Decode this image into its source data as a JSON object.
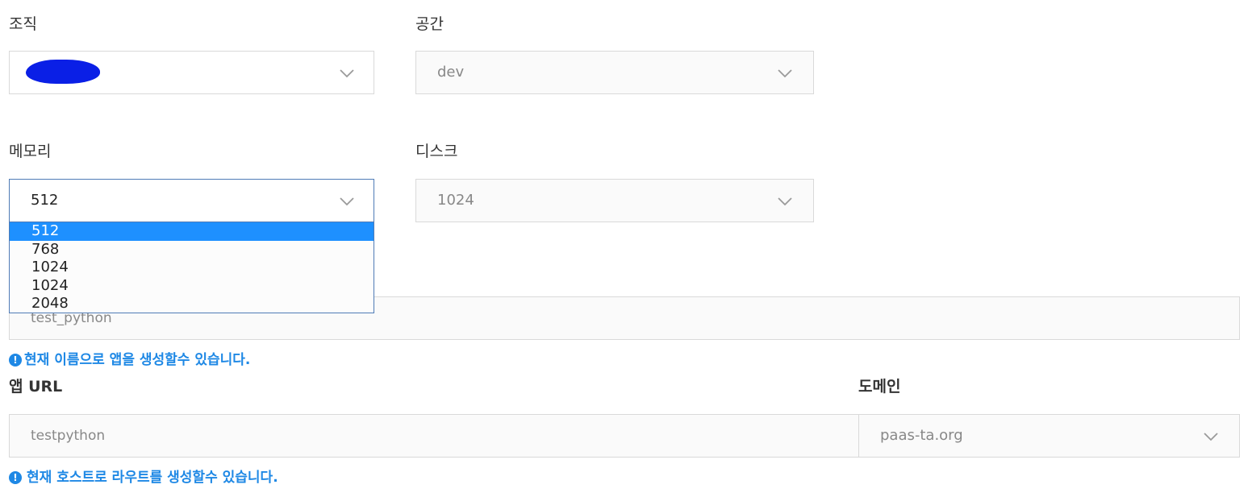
{
  "org": {
    "label": "조직",
    "icon": "chevron-down-icon"
  },
  "space": {
    "label": "공간",
    "value": "dev",
    "icon": "chevron-down-icon"
  },
  "memory": {
    "label": "메모리",
    "value": "512",
    "options": [
      "512",
      "768",
      "1024",
      "1024",
      "2048"
    ],
    "selected_index": 0,
    "icon": "chevron-down-icon"
  },
  "disk": {
    "label": "디스크",
    "value": "1024",
    "icon": "chevron-down-icon"
  },
  "app_name": {
    "value": "test_python",
    "hint": "현재 이름으로 앱을 생성할수 있습니다.",
    "hint_icon": "exclamation-circle-icon"
  },
  "app_url": {
    "label": "앱 URL",
    "value": "testpython",
    "hint": "현재 호스트로 라우트를 생성할수 있습니다.",
    "hint_icon": "exclamation-circle-icon"
  },
  "domain": {
    "label": "도메인",
    "value": "paas-ta.org",
    "icon": "chevron-down-icon"
  },
  "colors": {
    "accent": "#1e88e5",
    "selected_option_bg": "#1e90ff",
    "active_border": "#4f7bb6",
    "redaction_blob": "#0a1fe6"
  }
}
